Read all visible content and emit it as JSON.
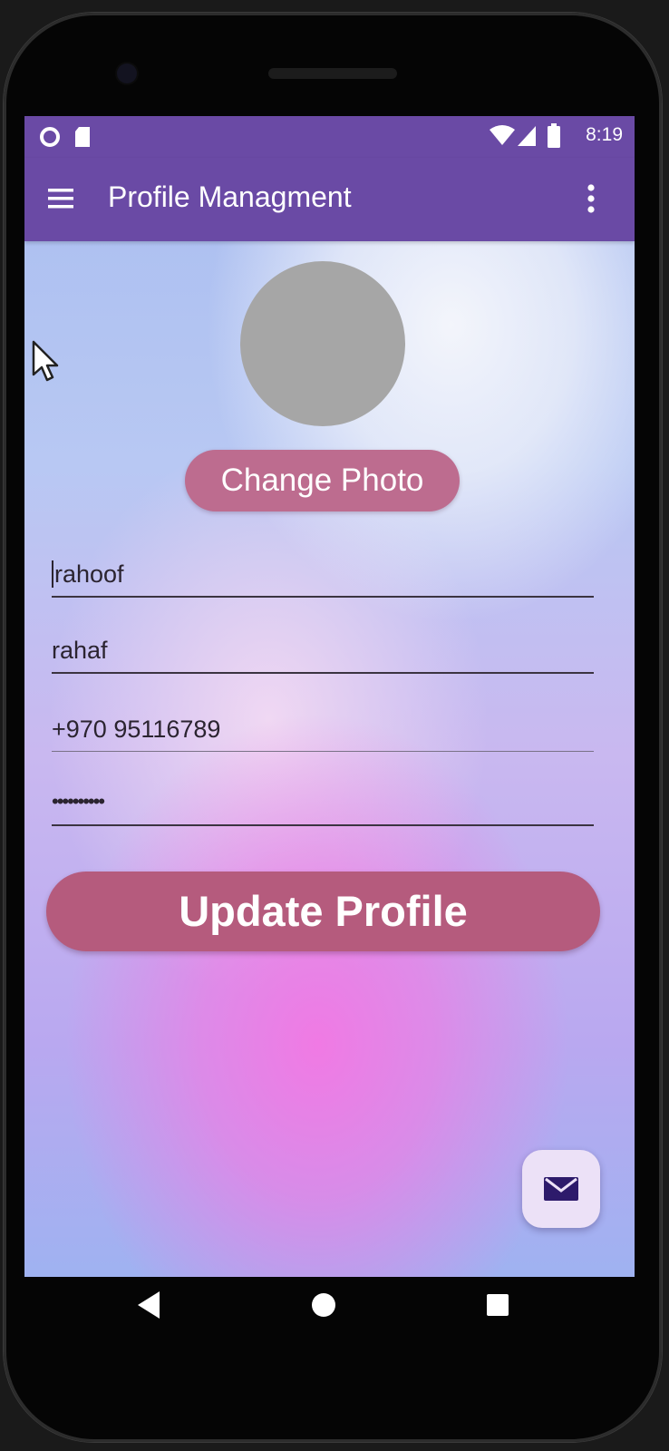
{
  "status_bar": {
    "time": "8:19",
    "left_icons": [
      "circle-status-icon",
      "sd-card-icon"
    ],
    "right_icons": [
      "wifi-icon",
      "signal-icon",
      "battery-icon"
    ]
  },
  "app_bar": {
    "title": "Profile Managment",
    "menu_icon": "hamburger-menu-icon",
    "overflow_icon": "more-vert-icon"
  },
  "profile": {
    "avatar": "profile-photo-placeholder",
    "change_photo_label": "Change Photo"
  },
  "form": {
    "fields": [
      {
        "value": "rahoof"
      },
      {
        "value": "rahaf"
      },
      {
        "value": "+970 95116789"
      },
      {
        "value": "••••••••••"
      }
    ],
    "update_label": "Update Profile"
  },
  "fab": {
    "icon": "mail-icon"
  },
  "nav_bar": {
    "back": "back-icon",
    "home": "home-icon",
    "recents": "recents-icon"
  },
  "colors": {
    "app_bar": "#6a4aa5",
    "change_photo_button": "#bd6c8f",
    "update_button": "#b55b7d",
    "avatar": "#a6a6a6",
    "fab": "#ece1f7",
    "fab_icon": "#2d1a6b"
  }
}
